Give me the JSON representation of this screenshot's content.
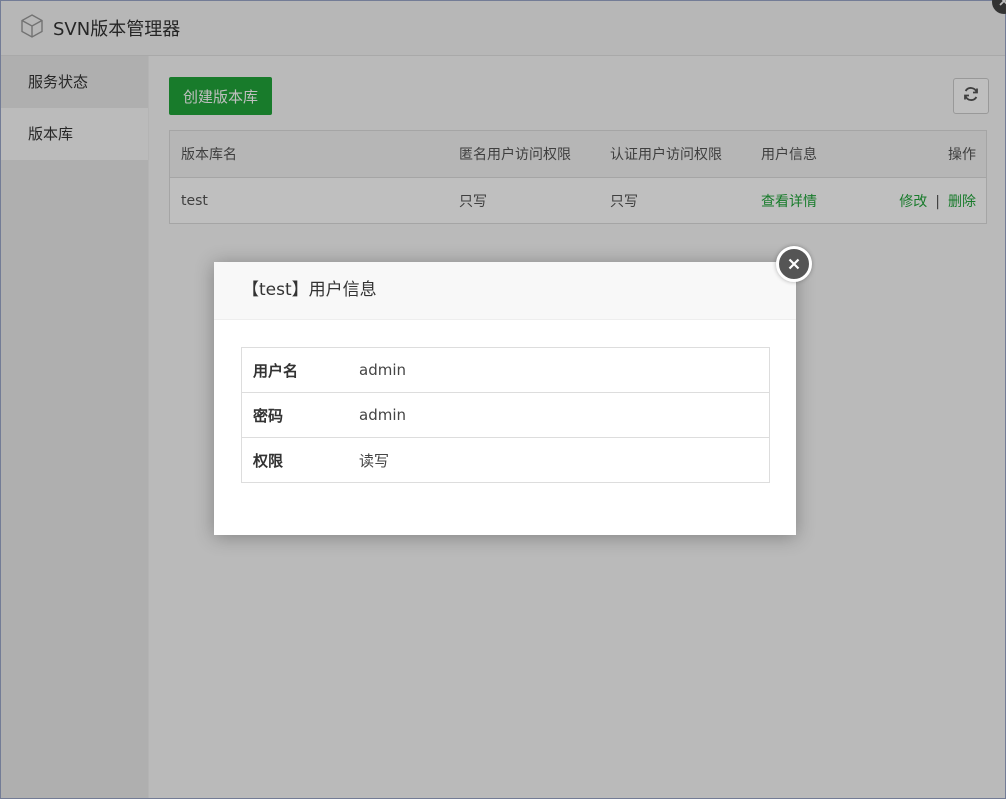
{
  "window": {
    "title": "SVN版本管理器"
  },
  "sidebar": {
    "items": [
      {
        "label": "服务状态"
      },
      {
        "label": "版本库"
      }
    ]
  },
  "toolbar": {
    "create_label": "创建版本库"
  },
  "repo_table": {
    "headers": [
      "版本库名",
      "匿名用户访问权限",
      "认证用户访问权限",
      "用户信息",
      "操作"
    ],
    "rows": [
      {
        "name": "test",
        "anon": "只写",
        "auth": "只写",
        "user_info": "查看详情",
        "edit": "修改",
        "separator": "|",
        "delete": "删除"
      }
    ]
  },
  "modal": {
    "title": "【test】用户信息",
    "fields": [
      {
        "label": "用户名",
        "value": "admin"
      },
      {
        "label": "密码",
        "value": "admin"
      },
      {
        "label": "权限",
        "value": "读写"
      }
    ]
  },
  "colors": {
    "accent": "#20a53a",
    "overlay": "rgba(0,0,0,0.25)"
  },
  "icons": [
    "cube-icon",
    "refresh-icon",
    "close-icon"
  ]
}
